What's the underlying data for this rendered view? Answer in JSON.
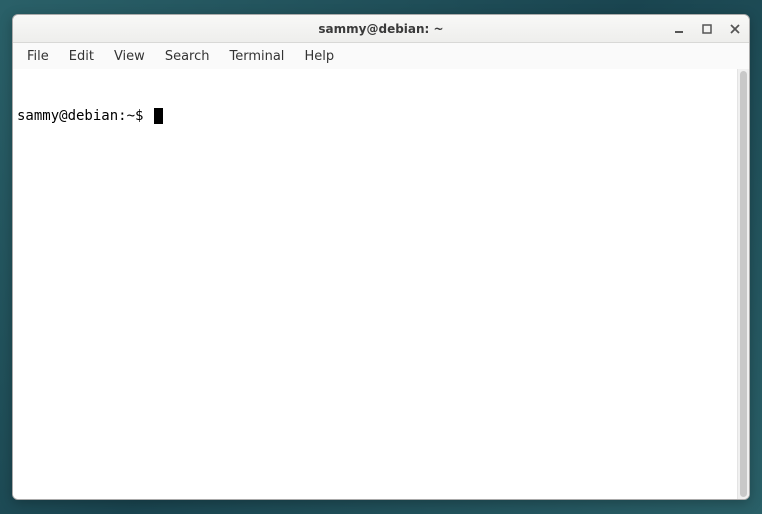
{
  "window": {
    "title": "sammy@debian: ~"
  },
  "menubar": {
    "items": [
      "File",
      "Edit",
      "View",
      "Search",
      "Terminal",
      "Help"
    ]
  },
  "terminal": {
    "prompt": "sammy@debian:~$ "
  }
}
